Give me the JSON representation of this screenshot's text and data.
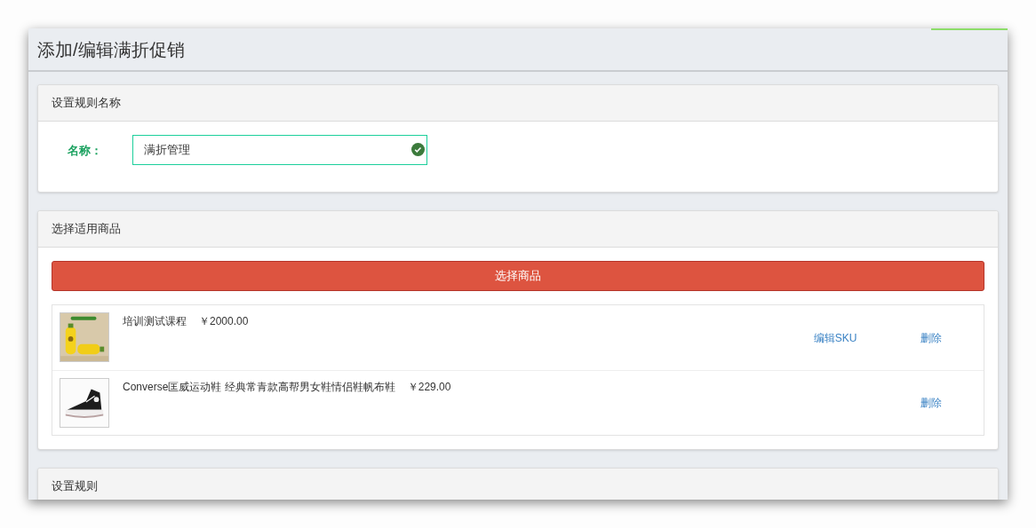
{
  "window": {
    "title": "添加/编辑满折促销"
  },
  "name_panel": {
    "title": "设置规则名称",
    "label": "名称：",
    "value": "满折管理",
    "valid": true
  },
  "goods_panel": {
    "title": "选择适用商品",
    "button": "选择商品",
    "products": [
      {
        "name": "培训测试课程",
        "price": "￥2000.00",
        "edit_sku": "编辑SKU",
        "delete": "删除"
      },
      {
        "name": "Converse匡威运动鞋 经典常青款高帮男女鞋情侣鞋帆布鞋",
        "price": "￥229.00",
        "delete": "删除"
      }
    ]
  },
  "rules_panel": {
    "title": "设置规则"
  }
}
